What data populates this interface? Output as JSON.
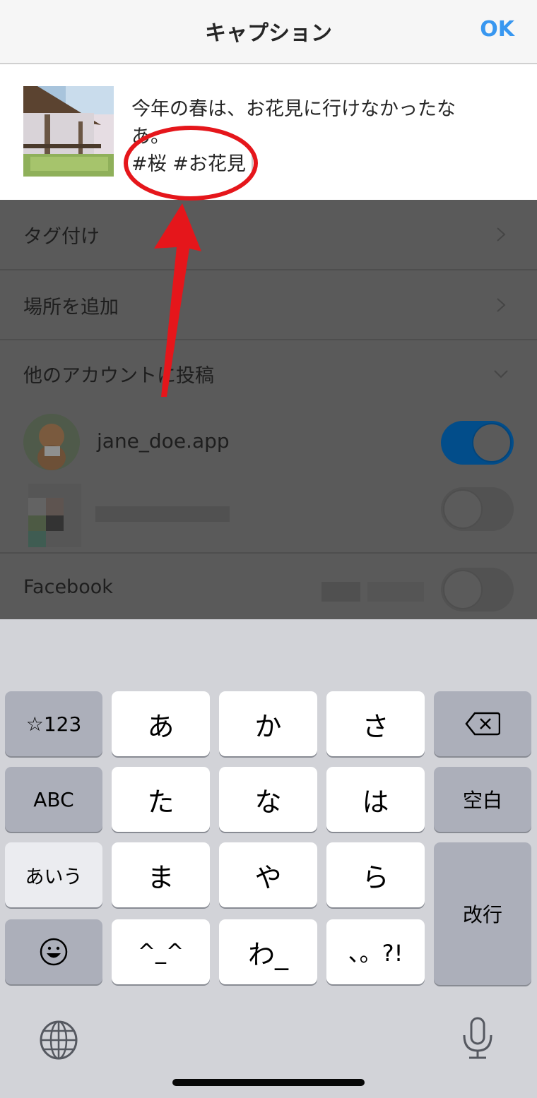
{
  "header": {
    "title": "キャプション",
    "ok_label": "OK"
  },
  "caption": {
    "thumbnail": "cherry-blossom-pavilion-photo",
    "line1": "今年の春は、お花見に行けなかったな",
    "line2": "あ。",
    "hashtags": "#桜 #お花見"
  },
  "options": {
    "tag_people": "タグ付け",
    "add_location": "場所を追加",
    "post_other_accounts": "他のアカウントに投稿"
  },
  "accounts": [
    {
      "name": "jane_doe.app",
      "enabled": true
    },
    {
      "name": "",
      "enabled": false,
      "blurred": true
    }
  ],
  "facebook": {
    "label": "Facebook",
    "enabled": false
  },
  "keyboard": {
    "row1": [
      "☆123",
      "あ",
      "か",
      "さ",
      "delete"
    ],
    "row2": [
      "ABC",
      "た",
      "な",
      "は",
      "空白"
    ],
    "row3": [
      "あいう",
      "ま",
      "や",
      "ら",
      "改行"
    ],
    "row4": [
      "emoji",
      "^_^",
      "わ_",
      "、。?!"
    ],
    "globe": "globe-icon",
    "mic": "microphone-icon"
  },
  "annotation": {
    "highlight_color": "#e5161b",
    "target": "hashtags"
  },
  "colors": {
    "accent": "#3897f0",
    "toggle_on": "#024d8a"
  }
}
